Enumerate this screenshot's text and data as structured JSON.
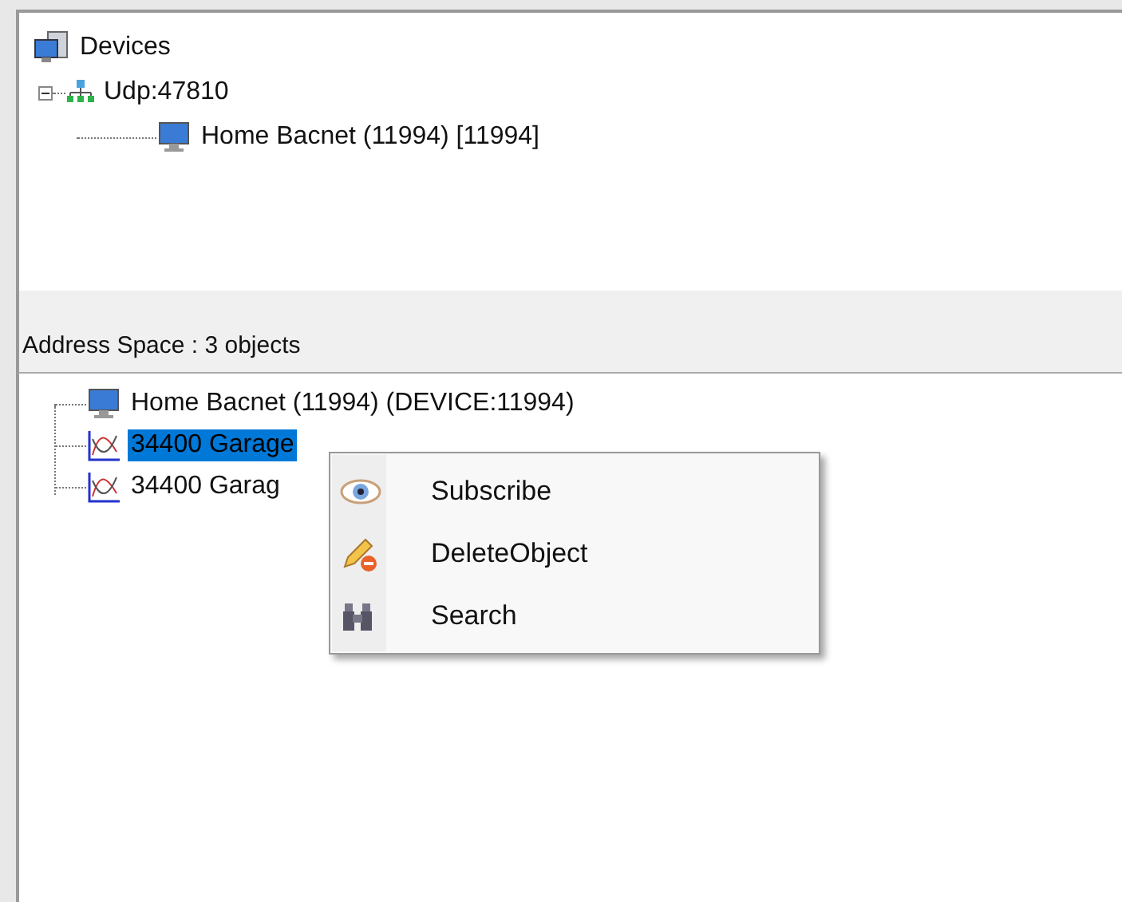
{
  "devices_tree": {
    "label": "Devices",
    "children": [
      {
        "label": "Udp:47810",
        "expanded": true,
        "children": [
          {
            "label": "Home Bacnet (11994) [11994]"
          }
        ]
      }
    ]
  },
  "address_space": {
    "header": "Address Space : 3 objects",
    "items": [
      {
        "label": "Home Bacnet (11994) (DEVICE:11994)",
        "kind": "device",
        "selected": false
      },
      {
        "label": "34400 Garage",
        "kind": "analog",
        "selected": true
      },
      {
        "label": "34400 Garag",
        "kind": "analog",
        "selected": false
      }
    ]
  },
  "context_menu": {
    "items": [
      {
        "label": "Subscribe",
        "kind": "subscribe"
      },
      {
        "label": "DeleteObject",
        "kind": "delete"
      },
      {
        "label": "Search",
        "kind": "search"
      }
    ]
  }
}
